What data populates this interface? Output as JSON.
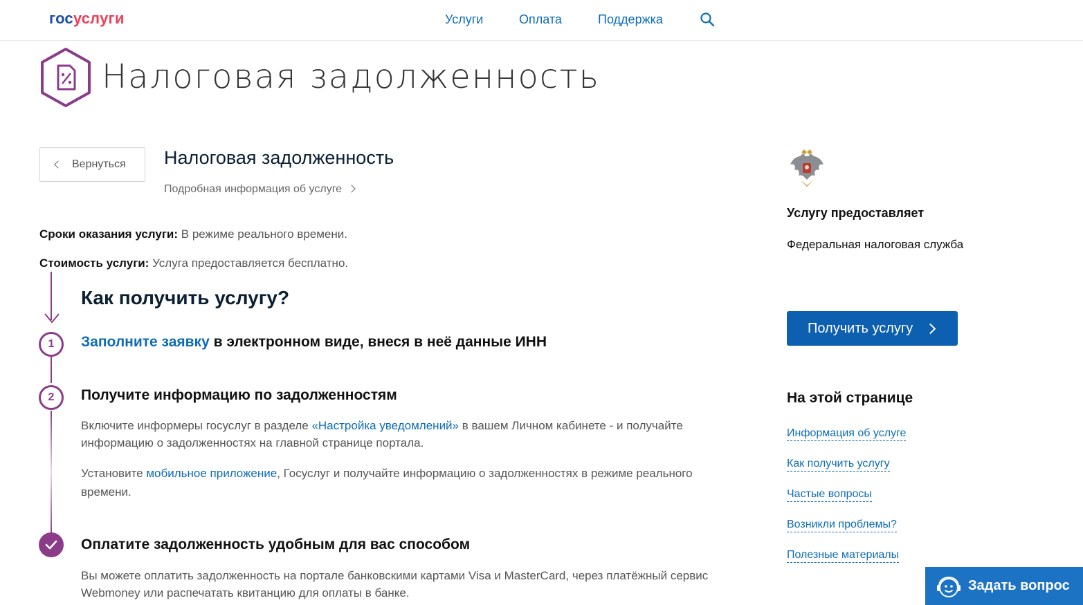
{
  "header": {
    "logo_part1": "гос",
    "logo_part2": "услуги",
    "nav": [
      "Услуги",
      "Оплата",
      "Поддержка"
    ]
  },
  "page_title": "Налоговая задолженность",
  "back_label": "Вернуться",
  "service": {
    "title": "Налоговая задолженность",
    "more_link": "Подробная информация об услуге"
  },
  "meta": {
    "terms_label": "Сроки оказания услуги:",
    "terms_value": "В режиме реального времени.",
    "cost_label": "Стоимость услуги:",
    "cost_value": "Услуга предоставляется бесплатно."
  },
  "how": {
    "title": "Как получить услугу?",
    "step1_num": "1",
    "step1_link": "Заполните заявку",
    "step1_rest": " в электронном виде, внеся в неё данные ИНН",
    "step2_num": "2",
    "step2_title": "Получите информацию по задолженностям",
    "step2_p1_a": "Включите информеры госуслуг в разделе ",
    "step2_p1_link": "«Настройка уведомлений»",
    "step2_p1_b": " в вашем Личном кабинете - и получайте информацию о задолженностях на главной странице портала.",
    "step2_p2_a": "Установите ",
    "step2_p2_link": "мобильное приложение",
    "step2_p2_b": ", Госуслуг и получайте информацию о задолженностях в режиме реального времени.",
    "step3_title": "Оплатите задолженность удобным для вас способом",
    "step3_text": "Вы можете оплатить задолженность на портале банковскими картами Visa и MasterCard, через платёжный сервис Webmoney или распечатать квитанцию для оплаты в банке."
  },
  "provider": {
    "label": "Услугу предоставляет",
    "name": "Федеральная налоговая служба"
  },
  "get_service_label": "Получить услугу",
  "toc": {
    "title": "На этой странице",
    "items": [
      "Информация об услуге",
      "Как получить услугу",
      "Частые вопросы",
      "Возникли проблемы?",
      "Полезные материалы"
    ]
  },
  "ask_label": "Задать вопрос",
  "colors": {
    "accent_purple": "#8b3c89",
    "link_blue": "#0d6cb4",
    "button_blue": "#0d5fb0"
  }
}
